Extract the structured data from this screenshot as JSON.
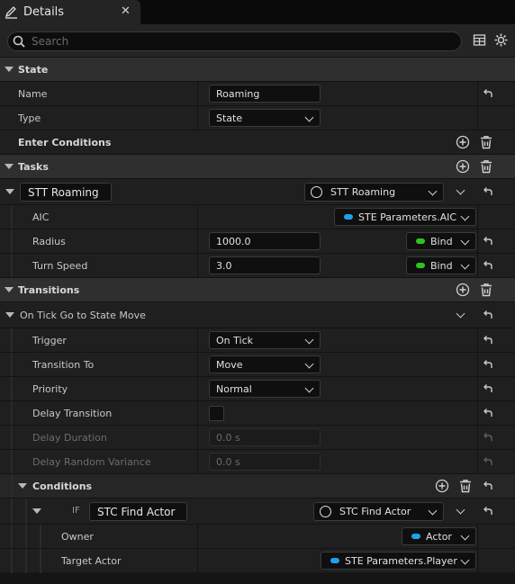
{
  "tab": {
    "title": "Details"
  },
  "search": {
    "placeholder": "Search"
  },
  "state_section": {
    "label": "State"
  },
  "name_row": {
    "label": "Name",
    "value": "Roaming"
  },
  "type_row": {
    "label": "Type",
    "value": "State"
  },
  "enter_conditions": {
    "label": "Enter Conditions"
  },
  "tasks_section": {
    "label": "Tasks"
  },
  "task": {
    "name": "STT Roaming",
    "class": "STT Roaming",
    "aic": {
      "label": "AIC",
      "value": "STE Parameters.AIC"
    },
    "radius": {
      "label": "Radius",
      "value": "1000.0",
      "bind": "Bind"
    },
    "turn_speed": {
      "label": "Turn Speed",
      "value": "3.0",
      "bind": "Bind"
    }
  },
  "transitions_section": {
    "label": "Transitions"
  },
  "transition": {
    "label": "On Tick Go to State Move",
    "trigger": {
      "label": "Trigger",
      "value": "On Tick"
    },
    "transition_to": {
      "label": "Transition To",
      "value": "Move"
    },
    "priority": {
      "label": "Priority",
      "value": "Normal"
    },
    "delay_transition": {
      "label": "Delay Transition",
      "checked": false
    },
    "delay_duration": {
      "label": "Delay Duration",
      "value": "0.0 s"
    },
    "delay_random_variance": {
      "label": "Delay Random Variance",
      "value": "0.0 s"
    }
  },
  "conditions_section": {
    "label": "Conditions"
  },
  "condition": {
    "prefix": "IF",
    "name": "STC Find Actor",
    "class": "STC Find Actor",
    "owner": {
      "label": "Owner",
      "value": "Actor"
    },
    "target_actor": {
      "label": "Target Actor",
      "value": "STE Parameters.Player"
    }
  },
  "colors": {
    "bind_green": "#2ec41e",
    "param_blue": "#1ea0f0"
  }
}
